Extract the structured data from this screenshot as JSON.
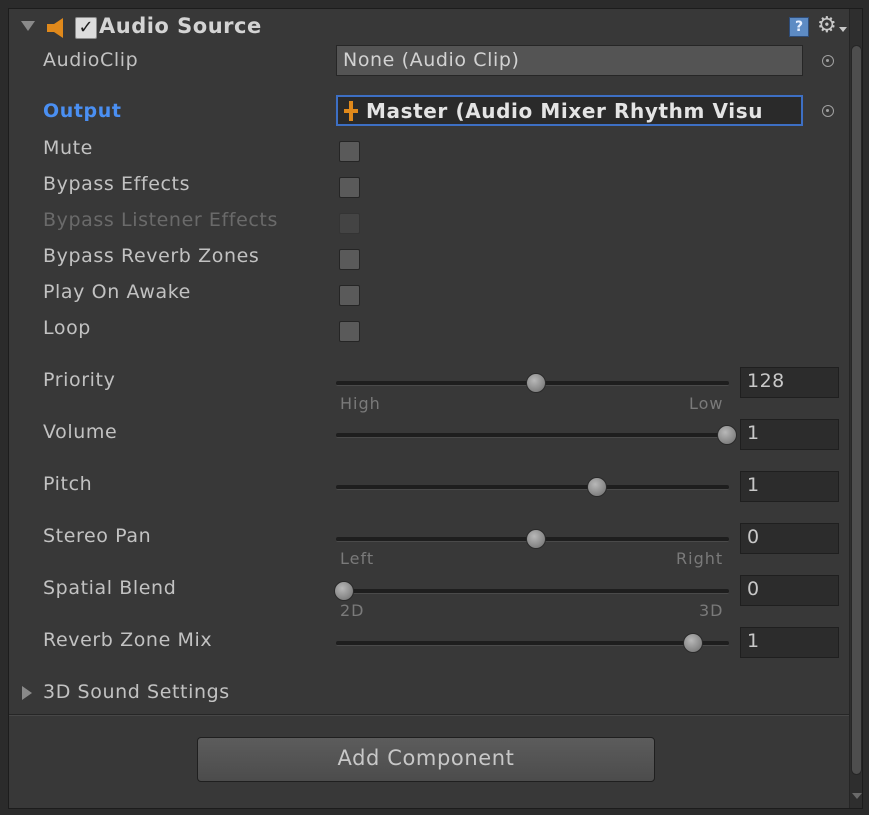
{
  "component": {
    "title": "Audio Source",
    "enabled_mark": "✓",
    "help_icon": "?",
    "gear_icon": "⚙"
  },
  "fields": {
    "audioclip": {
      "label": "AudioClip",
      "value": "None (Audio Clip)"
    },
    "output": {
      "label": "Output",
      "value": "Master (Audio Mixer Rhythm Visu"
    },
    "mute": {
      "label": "Mute"
    },
    "bypass_effects": {
      "label": "Bypass Effects"
    },
    "bypass_listener_effects": {
      "label": "Bypass Listener Effects"
    },
    "bypass_reverb_zones": {
      "label": "Bypass Reverb Zones"
    },
    "play_on_awake": {
      "label": "Play On Awake"
    },
    "loop": {
      "label": "Loop"
    }
  },
  "sliders": {
    "priority": {
      "label": "Priority",
      "value": "128",
      "min_label": "High",
      "max_label": "Low",
      "fraction": 0.5
    },
    "volume": {
      "label": "Volume",
      "value": "1",
      "fraction": 1.0
    },
    "pitch": {
      "label": "Pitch",
      "value": "1",
      "fraction": 0.66
    },
    "stereo_pan": {
      "label": "Stereo Pan",
      "value": "0",
      "min_label": "Left",
      "max_label": "Right",
      "fraction": 0.5
    },
    "spatial_blend": {
      "label": "Spatial Blend",
      "value": "0",
      "min_label": "2D",
      "max_label": "3D",
      "fraction": 0.0
    },
    "reverb_zone_mix": {
      "label": "Reverb Zone Mix",
      "value": "1",
      "fraction": 0.91
    }
  },
  "sound3d": {
    "label": "3D Sound Settings"
  },
  "add_component": {
    "label": "Add Component"
  },
  "colors": {
    "accent_output": "#4a8ff2",
    "speaker_orange": "#e0891b",
    "panel_bg": "#383838"
  }
}
